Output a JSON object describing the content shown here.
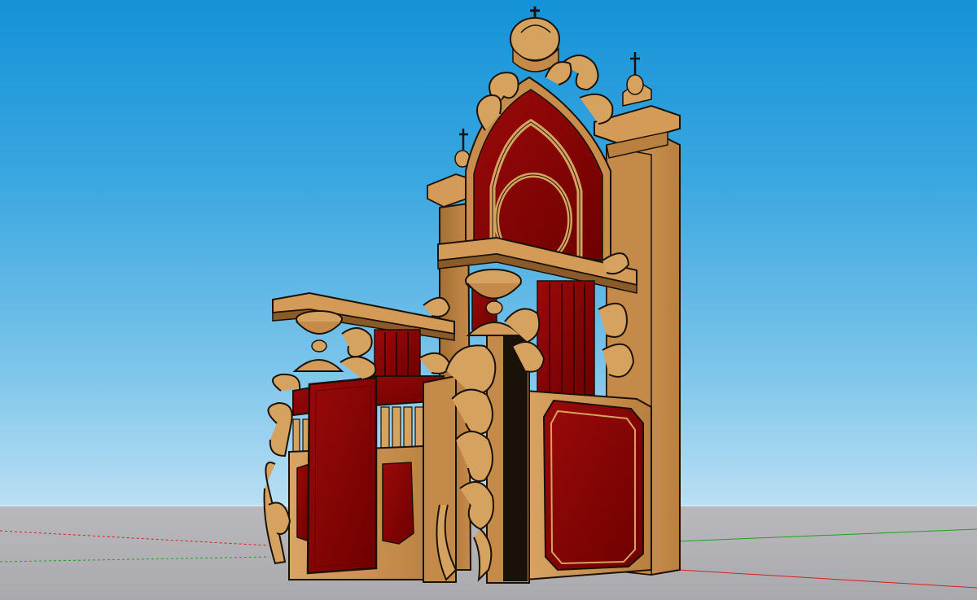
{
  "viewport": {
    "sky_top_color": "#1592d8",
    "sky_horizon_color": "#d7ecf7",
    "ground_color": "#b0b0b4"
  },
  "model": {
    "subject": "throne",
    "wood_color": "#c9914f",
    "wood_shade_color": "#a36f35",
    "velvet_color": "#8b0000",
    "velvet_dark_color": "#5c0000",
    "edge_color": "#1a1208"
  },
  "axes": {
    "red_axis_color": "#d42020",
    "green_axis_color": "#1fa01f"
  }
}
